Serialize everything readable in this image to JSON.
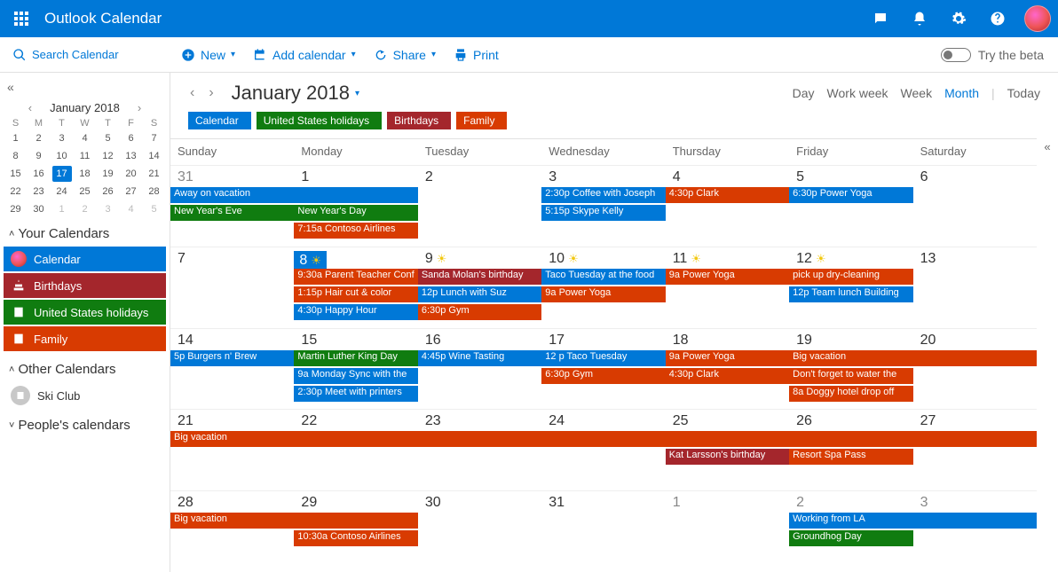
{
  "header": {
    "app_title": "Outlook Calendar"
  },
  "toolbar": {
    "search_placeholder": "Search Calendar",
    "new": "New",
    "add_calendar": "Add calendar",
    "share": "Share",
    "print": "Print",
    "try_beta": "Try the beta"
  },
  "sidebar": {
    "mini_title": "January 2018",
    "dow": [
      "S",
      "M",
      "T",
      "W",
      "T",
      "F",
      "S"
    ],
    "mini_days": [
      {
        "n": 1
      },
      {
        "n": 2
      },
      {
        "n": 3
      },
      {
        "n": 4
      },
      {
        "n": 5
      },
      {
        "n": 6
      },
      {
        "n": 7
      },
      {
        "n": 8
      },
      {
        "n": 9
      },
      {
        "n": 10
      },
      {
        "n": 11
      },
      {
        "n": 12
      },
      {
        "n": 13
      },
      {
        "n": 14
      },
      {
        "n": 15
      },
      {
        "n": 16
      },
      {
        "n": 17,
        "sel": true
      },
      {
        "n": 18
      },
      {
        "n": 19
      },
      {
        "n": 20
      },
      {
        "n": 21
      },
      {
        "n": 22
      },
      {
        "n": 23
      },
      {
        "n": 24
      },
      {
        "n": 25
      },
      {
        "n": 26
      },
      {
        "n": 27
      },
      {
        "n": 28
      },
      {
        "n": 29
      },
      {
        "n": 30
      },
      {
        "n": 1,
        "out": true
      },
      {
        "n": 2,
        "out": true
      },
      {
        "n": 3,
        "out": true
      },
      {
        "n": 4,
        "out": true
      },
      {
        "n": 5,
        "out": true
      }
    ],
    "your_calendars": "Your Calendars",
    "other_calendars": "Other Calendars",
    "peoples_calendars": "People's calendars",
    "calendars": [
      {
        "label": "Calendar",
        "color": "cal-blue",
        "icon": "avatar"
      },
      {
        "label": "Birthdays",
        "color": "cal-red",
        "icon": "cake"
      },
      {
        "label": "United States holidays",
        "color": "cal-green",
        "icon": "cal"
      },
      {
        "label": "Family",
        "color": "cal-orange",
        "icon": "cal"
      }
    ],
    "other_items": [
      {
        "label": "Ski Club"
      }
    ]
  },
  "main": {
    "title": "January 2018",
    "views": {
      "day": "Day",
      "workweek": "Work week",
      "week": "Week",
      "month": "Month",
      "today": "Today"
    },
    "legends": [
      {
        "label": "Calendar",
        "color": "ev-blue"
      },
      {
        "label": "United States holidays",
        "color": "ev-green"
      },
      {
        "label": "Birthdays",
        "color": "ev-red"
      },
      {
        "label": "Family",
        "color": "ev-orange"
      }
    ],
    "dow": [
      "Sunday",
      "Monday",
      "Tuesday",
      "Wednesday",
      "Thursday",
      "Friday",
      "Saturday"
    ]
  },
  "chart_data": {
    "type": "table",
    "month": "January 2018",
    "weeks": [
      {
        "days": [
          {
            "num": "31",
            "out": true,
            "events": [
              {
                "t": "Away on vacation",
                "c": "ev-blue",
                "row": 0
              },
              {
                "t": "New Year's Eve",
                "c": "ev-green",
                "row": 1
              }
            ]
          },
          {
            "num": "1",
            "events": [
              {
                "t": "New Year's Day",
                "c": "ev-green",
                "row": 1
              },
              {
                "t": "7:15a Contoso Airlines",
                "c": "ev-orange",
                "row": 2
              }
            ]
          },
          {
            "num": "2",
            "events": []
          },
          {
            "num": "3",
            "events": [
              {
                "t": "2:30p Coffee with Joseph",
                "c": "ev-blue",
                "row": 0
              },
              {
                "t": "5:15p Skype Kelly",
                "c": "ev-blue",
                "row": 1
              }
            ]
          },
          {
            "num": "4",
            "events": [
              {
                "t": "4:30p Clark",
                "c": "ev-orange",
                "row": 0
              }
            ]
          },
          {
            "num": "5",
            "events": [
              {
                "t": "6:30p Power Yoga",
                "c": "ev-blue",
                "row": 0
              }
            ]
          },
          {
            "num": "6",
            "events": []
          }
        ],
        "spans": [
          {
            "t": "Away on vacation",
            "c": "ev-blue",
            "startCol": 0,
            "endCol": 1,
            "row": 0
          }
        ]
      },
      {
        "days": [
          {
            "num": "7",
            "events": []
          },
          {
            "num": "8",
            "sun": true,
            "sel": true,
            "events": [
              {
                "t": "9:30a Parent Teacher Conf",
                "c": "ev-orange",
                "row": 0
              },
              {
                "t": "1:15p Hair cut & color",
                "c": "ev-orange",
                "row": 1
              },
              {
                "t": "4:30p Happy Hour",
                "c": "ev-blue",
                "row": 2
              }
            ]
          },
          {
            "num": "9",
            "sun": true,
            "events": [
              {
                "t": "Sanda Molan's birthday",
                "c": "ev-red",
                "row": 0
              },
              {
                "t": "12p Lunch with Suz",
                "c": "ev-blue",
                "row": 1
              },
              {
                "t": "6:30p Gym",
                "c": "ev-orange",
                "row": 2
              }
            ]
          },
          {
            "num": "10",
            "sun": true,
            "events": [
              {
                "t": "Taco Tuesday at the food",
                "c": "ev-blue",
                "row": 0
              },
              {
                "t": "9a Power Yoga",
                "c": "ev-orange",
                "row": 1
              }
            ]
          },
          {
            "num": "11",
            "sun": true,
            "events": [
              {
                "t": "9a Power Yoga",
                "c": "ev-orange",
                "row": 0
              }
            ]
          },
          {
            "num": "12",
            "sun": true,
            "events": [
              {
                "t": "pick up dry-cleaning",
                "c": "ev-orange",
                "row": 0
              },
              {
                "t": "12p Team lunch Building",
                "c": "ev-blue",
                "row": 1
              }
            ]
          },
          {
            "num": "13",
            "events": []
          }
        ]
      },
      {
        "days": [
          {
            "num": "14",
            "events": [
              {
                "t": "5p Burgers n' Brew",
                "c": "ev-blue",
                "row": 0
              }
            ]
          },
          {
            "num": "15",
            "events": [
              {
                "t": "Martin Luther King Day",
                "c": "ev-green",
                "row": 0
              },
              {
                "t": "9a Monday Sync with the",
                "c": "ev-blue",
                "row": 1
              },
              {
                "t": "2:30p Meet with printers",
                "c": "ev-blue",
                "row": 2
              }
            ]
          },
          {
            "num": "16",
            "events": [
              {
                "t": "4:45p Wine Tasting",
                "c": "ev-blue",
                "row": 0
              }
            ]
          },
          {
            "num": "17",
            "events": [
              {
                "t": "12 p Taco Tuesday",
                "c": "ev-blue",
                "row": 0
              },
              {
                "t": "6:30p Gym",
                "c": "ev-orange",
                "row": 1
              }
            ]
          },
          {
            "num": "18",
            "events": [
              {
                "t": "9a Power Yoga",
                "c": "ev-orange",
                "row": 0
              },
              {
                "t": "4:30p Clark",
                "c": "ev-orange",
                "row": 1
              }
            ]
          },
          {
            "num": "19",
            "events": [
              {
                "t": "Big vacation",
                "c": "ev-orange",
                "row": 0
              },
              {
                "t": "Don't forget to water the",
                "c": "ev-orange",
                "row": 1
              },
              {
                "t": "8a Doggy hotel drop off",
                "c": "ev-orange",
                "row": 2
              }
            ]
          },
          {
            "num": "20",
            "events": []
          }
        ],
        "spans": [
          {
            "t": "Big vacation",
            "c": "ev-orange",
            "startCol": 5,
            "endCol": 6,
            "row": 0
          }
        ]
      },
      {
        "days": [
          {
            "num": "21",
            "events": []
          },
          {
            "num": "22",
            "events": []
          },
          {
            "num": "23",
            "events": []
          },
          {
            "num": "24",
            "events": []
          },
          {
            "num": "25",
            "events": [
              {
                "t": "Kat Larsson's birthday",
                "c": "ev-red",
                "row": 1
              }
            ]
          },
          {
            "num": "26",
            "events": [
              {
                "t": "Resort Spa Pass",
                "c": "ev-orange",
                "row": 1
              }
            ]
          },
          {
            "num": "27",
            "events": []
          }
        ],
        "spans": [
          {
            "t": "Big vacation",
            "c": "ev-orange",
            "startCol": 0,
            "endCol": 6,
            "row": 0
          }
        ]
      },
      {
        "days": [
          {
            "num": "28",
            "events": []
          },
          {
            "num": "29",
            "events": [
              {
                "t": "10:30a Contoso Airlines",
                "c": "ev-orange",
                "row": 1
              }
            ]
          },
          {
            "num": "30",
            "events": []
          },
          {
            "num": "31",
            "events": []
          },
          {
            "num": "1",
            "out": true,
            "events": []
          },
          {
            "num": "2",
            "out": true,
            "events": [
              {
                "t": "Working from LA",
                "c": "ev-blue",
                "row": 0
              },
              {
                "t": "Groundhog Day",
                "c": "ev-green",
                "row": 1
              }
            ]
          },
          {
            "num": "3",
            "out": true,
            "events": []
          }
        ],
        "spans": [
          {
            "t": "Big vacation",
            "c": "ev-orange",
            "startCol": 0,
            "endCol": 1,
            "row": 0
          },
          {
            "t": "Working from LA",
            "c": "ev-blue",
            "startCol": 5,
            "endCol": 6,
            "row": 0
          }
        ]
      }
    ]
  }
}
